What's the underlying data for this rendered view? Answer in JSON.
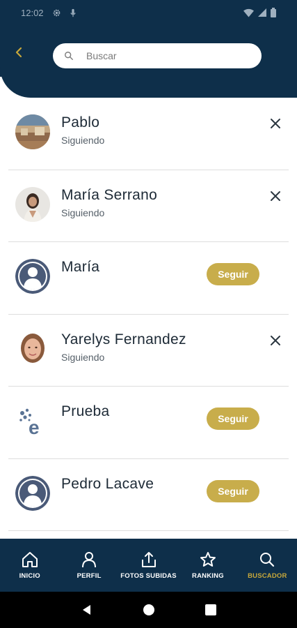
{
  "status": {
    "time": "12:02"
  },
  "search": {
    "placeholder": "Buscar",
    "value": ""
  },
  "users": [
    {
      "name": "Pablo",
      "status": "Siguiendo",
      "action": "remove",
      "avatar": "photo-landscape"
    },
    {
      "name": "María Serrano",
      "status": "Siguiendo",
      "action": "remove",
      "avatar": "photo-woman"
    },
    {
      "name": "María",
      "status": "",
      "action": "follow",
      "follow_label": "Seguir",
      "avatar": "default-avatar"
    },
    {
      "name": "Yarelys Fernandez",
      "status": "Siguiendo",
      "action": "remove",
      "avatar": "photo-girl"
    },
    {
      "name": "Prueba",
      "status": "",
      "action": "follow",
      "follow_label": "Seguir",
      "avatar": "e-logo"
    },
    {
      "name": "Pedro Lacave",
      "status": "",
      "action": "follow",
      "follow_label": "Seguir",
      "avatar": "default-avatar"
    }
  ],
  "nav": [
    {
      "label": "INICIO",
      "icon": "home-icon",
      "active": false
    },
    {
      "label": "PERFIL",
      "icon": "user-icon",
      "active": false
    },
    {
      "label": "FOTOS SUBIDAS",
      "icon": "upload-icon",
      "active": false
    },
    {
      "label": "RANKING",
      "icon": "star-icon",
      "active": false
    },
    {
      "label": "BUSCADOR",
      "icon": "search-icon",
      "active": true
    }
  ],
  "colors": {
    "primary": "#0e2f4a",
    "accent": "#c8a83a",
    "button": "#c8ad4b"
  }
}
